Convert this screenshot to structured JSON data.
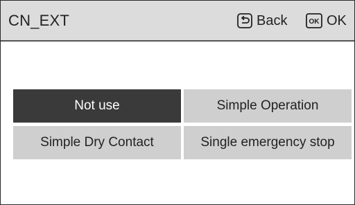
{
  "header": {
    "title": "CN_EXT",
    "back_label": "Back",
    "ok_label": "OK",
    "back_icon": "return-arrow-icon",
    "ok_icon": "ok-key-icon",
    "ok_icon_text": "OK"
  },
  "options": [
    {
      "label": "Not use",
      "selected": true
    },
    {
      "label": "Simple Operation",
      "selected": false
    },
    {
      "label": "Simple Dry Contact",
      "selected": false
    },
    {
      "label": "Single emergency stop",
      "selected": false
    }
  ],
  "colors": {
    "header_bg": "#dcdcdc",
    "selected_bg": "#3a3a3a",
    "option_bg": "#cfcfcf"
  }
}
